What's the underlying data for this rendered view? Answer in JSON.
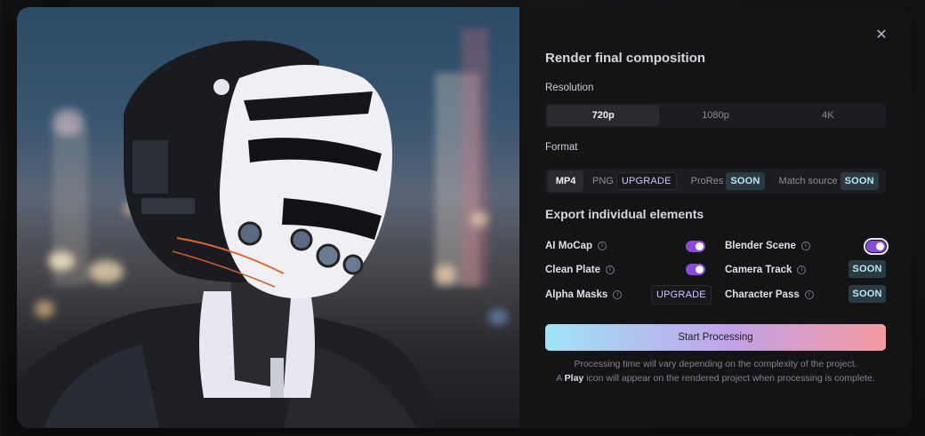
{
  "dialog": {
    "title": "Render final composition",
    "close_icon": "close-icon",
    "close_glyph": "✕"
  },
  "resolution": {
    "label": "Resolution",
    "options": [
      "720p",
      "1080p",
      "4K"
    ],
    "selected": "720p"
  },
  "format": {
    "label": "Format",
    "selected": "MP4",
    "mp4": "MP4",
    "png": "PNG",
    "png_tag": "UPGRADE",
    "prores": "ProRes",
    "prores_tag": "SOON",
    "match": "Match source",
    "match_tag": "SOON"
  },
  "export": {
    "title": "Export individual elements",
    "items": [
      {
        "label": "AI MoCap",
        "state": "on"
      },
      {
        "label": "Clean Plate",
        "state": "on"
      },
      {
        "label": "Alpha Masks",
        "state": "upgrade",
        "tag": "UPGRADE"
      },
      {
        "label": "Blender Scene",
        "state": "on"
      },
      {
        "label": "Camera Track",
        "state": "soon",
        "tag": "SOON"
      },
      {
        "label": "Character Pass",
        "state": "soon",
        "tag": "SOON"
      }
    ],
    "info_glyph": "i"
  },
  "start_button": "Start Processing",
  "notes": {
    "line1": "Processing time will vary depending on the complexity of the project.",
    "line2_pre": "A",
    "line2_bold": "Play",
    "line2_post": "icon will appear on the rendered project when processing is complete."
  },
  "colors": {
    "accent_toggle": "#8b4ad8",
    "soon_bg": "#2b3a40",
    "soon_text": "#b8e8f2",
    "upgrade_text": "#cfc4ff",
    "gradient": [
      "#9fe3f5",
      "#c2a2e8",
      "#f59aa0"
    ]
  }
}
